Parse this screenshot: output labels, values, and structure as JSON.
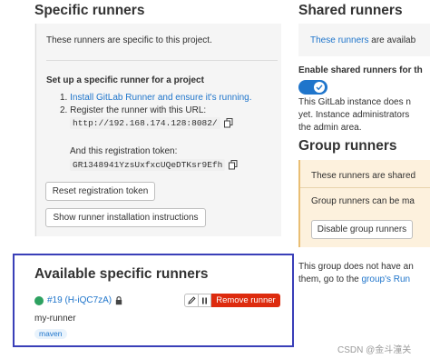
{
  "specific_runners": {
    "title": "Specific runners",
    "intro": "These runners are specific to this project.",
    "setup_title": "Set up a specific runner for a project",
    "step1_num": "1.",
    "step1_link": "Install GitLab Runner and ensure it's running.",
    "step2_num": "2.",
    "step2_text": "Register the runner with this URL:",
    "url": "http://192.168.174.128:8082/",
    "token_label": "And this registration token:",
    "token": "GR1348941YzsUxfxcUQeDTKsr9Efh",
    "reset_button": "Reset registration token",
    "show_instructions_button": "Show runner installation instructions"
  },
  "available_runners": {
    "title": "Available specific runners",
    "runner": {
      "status_color": "#2da160",
      "id_link": "#19 (H-iQC7zA)",
      "description": "my-runner",
      "tag": "maven",
      "remove_button": "Remove runner"
    }
  },
  "shared_runners": {
    "title": "Shared runners",
    "info_link": "These runners",
    "info_rest": " are availab",
    "enable_label": "Enable shared runners for th",
    "toggle_on": true,
    "note_line1": "This GitLab instance does n",
    "note_line2": "yet. Instance administrators",
    "note_line3": "the admin area."
  },
  "group_runners": {
    "title": "Group runners",
    "warning_line1": "These runners are shared",
    "warning_line2": "Group runners can be ma",
    "disable_button": "Disable group runners",
    "footer_line1": "This group does not have an",
    "footer_line2_prefix": "them, go to the ",
    "footer_line2_link": "group's Run"
  },
  "watermark": "CSDN @金斗潼关",
  "colors": {
    "link": "#1f75cb",
    "danger": "#dd2b0e",
    "highlight_border": "#3a3fb8",
    "warning_bg": "#fdf1dd",
    "warning_border": "#e9be74",
    "tag_bg": "#e9f3fc",
    "toggle": "#1f75cb"
  }
}
